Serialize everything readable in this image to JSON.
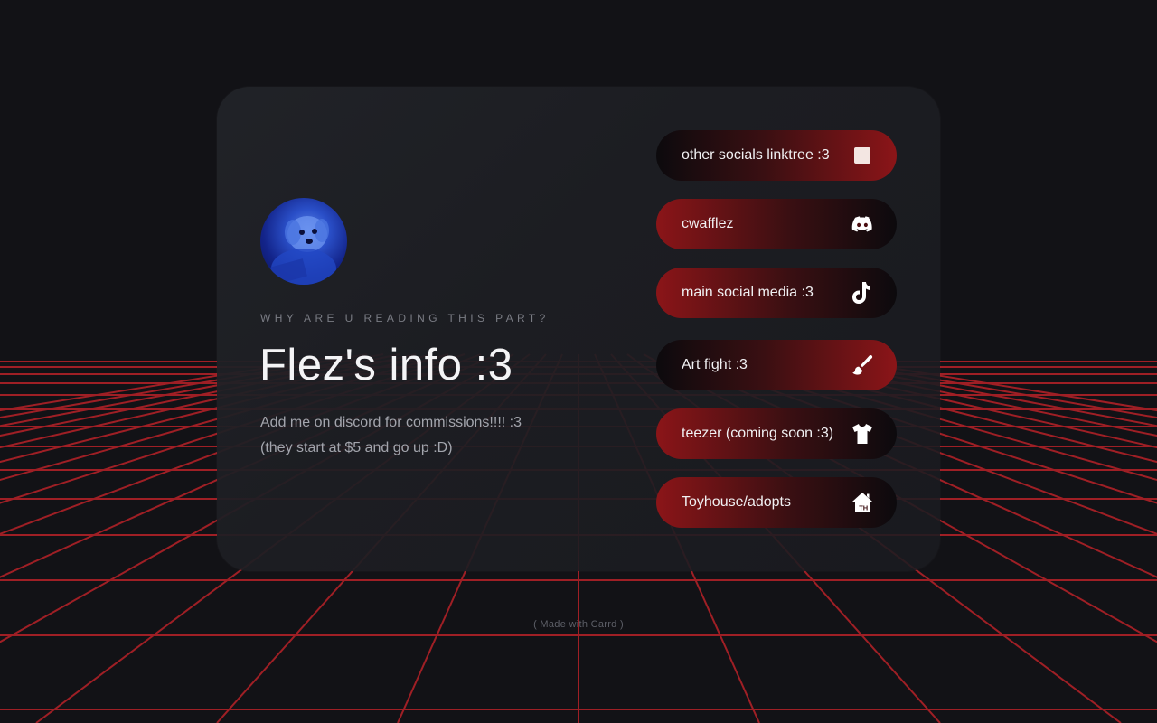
{
  "profile": {
    "avatar_alt": "",
    "tagline": "WHY ARE U READING THIS PART?",
    "title": "Flez's info :3",
    "description_lines": [
      "Add me on discord for commissions!!!! :3",
      "(they start at $5 and go up :D)"
    ]
  },
  "links": [
    {
      "label": "other socials linktree :3",
      "icon": "linktree-square-icon"
    },
    {
      "label": "cwafflez",
      "icon": "discord-icon"
    },
    {
      "label": "main social media :3",
      "icon": "tiktok-icon"
    },
    {
      "label": "Art fight :3",
      "icon": "paintbrush-icon"
    },
    {
      "label": "teezer (coming soon :3)",
      "icon": "tshirt-icon"
    },
    {
      "label": "Toyhouse/adopts",
      "icon": "toyhouse-icon"
    }
  ],
  "footer": {
    "text": "( Made with Carrd )"
  },
  "colors": {
    "background": "#121216",
    "grid_red": "#c4262c",
    "button_red": "#8b1518",
    "button_dark": "#0c0a0d",
    "card": "#1f2126"
  }
}
